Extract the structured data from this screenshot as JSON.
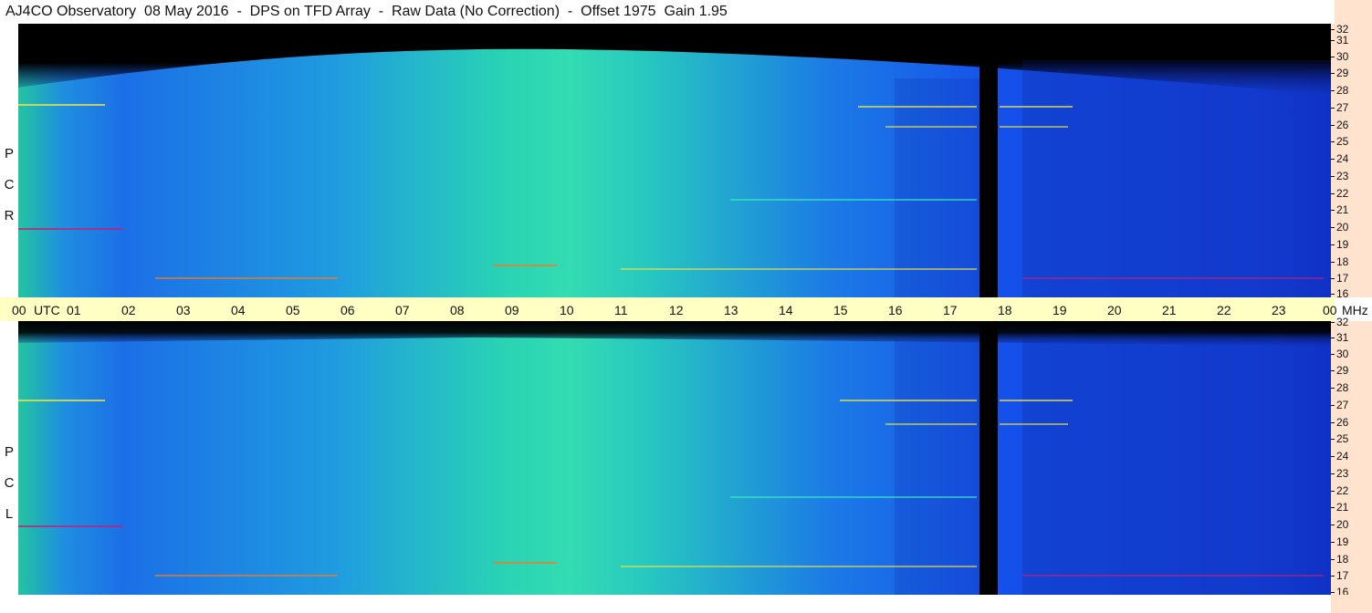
{
  "title": "AJ4CO Observatory  08 May 2016  -  DPS on TFD Array  -  Raw Data (No Correction)  -  Offset 1975  Gain 1.95",
  "polarization_top": [
    "P",
    "C",
    "R"
  ],
  "polarization_bottom": [
    "P",
    "C",
    "L"
  ],
  "time_axis": {
    "labels": [
      "00",
      "UTC",
      "01",
      "02",
      "03",
      "04",
      "05",
      "06",
      "07",
      "08",
      "09",
      "10",
      "11",
      "12",
      "13",
      "14",
      "15",
      "16",
      "17",
      "18",
      "19",
      "20",
      "21",
      "22",
      "23",
      "00",
      "MHz"
    ]
  },
  "freq_axis": {
    "labels": [
      "32",
      "31",
      "30",
      "29",
      "28",
      "27",
      "26",
      "25",
      "24",
      "23",
      "22",
      "21",
      "20",
      "19",
      "18",
      "17",
      "16"
    ]
  },
  "chart_data": [
    {
      "type": "heatmap",
      "panel": "RCP",
      "x_unit": "UTC hour",
      "y_unit": "MHz",
      "xlim": [
        0,
        24
      ],
      "ylim": [
        16,
        32
      ],
      "x_ticks": [
        "00",
        "01",
        "02",
        "03",
        "04",
        "05",
        "06",
        "07",
        "08",
        "09",
        "10",
        "11",
        "12",
        "13",
        "14",
        "15",
        "16",
        "17",
        "18",
        "19",
        "20",
        "21",
        "22",
        "23",
        "00"
      ],
      "y_ticks": [
        32,
        31,
        30,
        29,
        28,
        27,
        26,
        25,
        24,
        23,
        22,
        21,
        20,
        19,
        18,
        17,
        16
      ],
      "data_gap_utc": [
        17.6,
        17.9
      ],
      "colormap": [
        "#000000",
        "#0a1a80",
        "#1442e0",
        "#1f8ee0",
        "#2ad6b0",
        "#e8e44a",
        "#f07a2a",
        "#c0207a"
      ]
    },
    {
      "type": "heatmap",
      "panel": "LCP",
      "x_unit": "UTC hour",
      "y_unit": "MHz",
      "xlim": [
        0,
        24
      ],
      "ylim": [
        16,
        32
      ],
      "x_ticks": [
        "00",
        "01",
        "02",
        "03",
        "04",
        "05",
        "06",
        "07",
        "08",
        "09",
        "10",
        "11",
        "12",
        "13",
        "14",
        "15",
        "16",
        "17",
        "18",
        "19",
        "20",
        "21",
        "22",
        "23",
        "00"
      ],
      "y_ticks": [
        32,
        31,
        30,
        29,
        28,
        27,
        26,
        25,
        24,
        23,
        22,
        21,
        20,
        19,
        18,
        17,
        16
      ],
      "data_gap_utc": [
        17.6,
        17.9
      ],
      "colormap": [
        "#000000",
        "#0a1a80",
        "#1442e0",
        "#1f8ee0",
        "#2ad6b0",
        "#e8e44a",
        "#f07a2a",
        "#c0207a"
      ]
    }
  ]
}
